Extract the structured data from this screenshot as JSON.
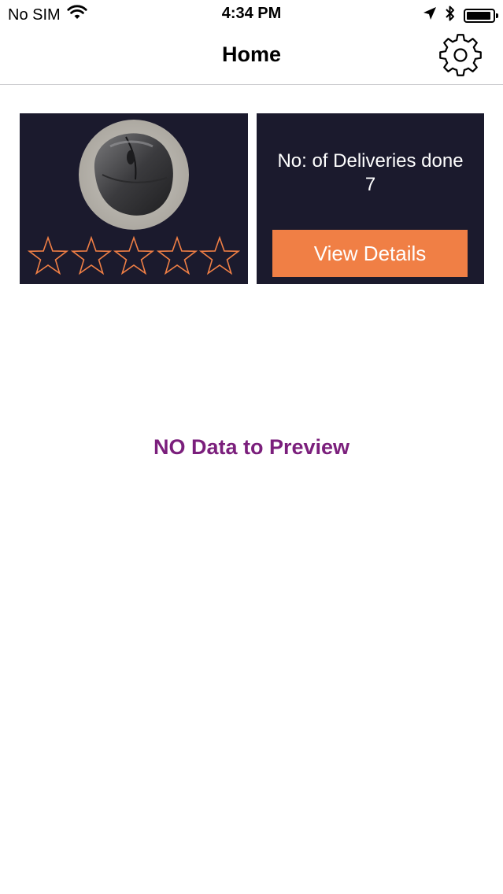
{
  "status_bar": {
    "carrier": "No SIM",
    "time": "4:34 PM",
    "icons": [
      "wifi-icon",
      "location-arrow-icon",
      "bluetooth-icon",
      "battery-icon"
    ]
  },
  "nav": {
    "title": "Home",
    "settings_icon": "gear-icon"
  },
  "profile_card": {
    "avatar": "avatar-photo",
    "rating": 0,
    "max_rating": 5
  },
  "deliveries_card": {
    "label": "No: of Deliveries done",
    "count": "7",
    "button_label": "View Details"
  },
  "main": {
    "empty_message": "NO Data to Preview"
  },
  "colors": {
    "card_background": "#1b1a2d",
    "accent": "#f07f45",
    "empty_message": "#7b1f7c"
  }
}
